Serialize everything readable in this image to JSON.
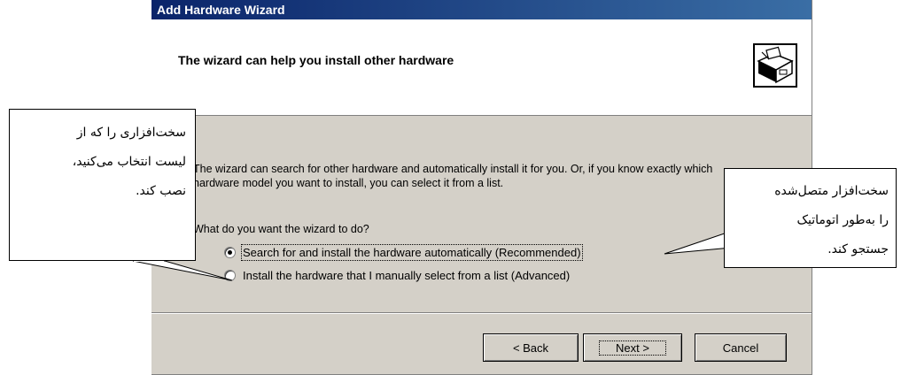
{
  "window": {
    "title": "Add Hardware Wizard"
  },
  "header": {
    "title": "The wizard can help you install other hardware",
    "icon": "hardware-install-icon"
  },
  "content": {
    "description": "The wizard can search for other hardware and automatically install it for you. Or, if you know exactly which hardware model you want to install, you can select it from a list.",
    "question": "What do you want the wizard to do?",
    "options": [
      {
        "label": "Search for and install the hardware automatically (Recommended)",
        "selected": true
      },
      {
        "label": "Install the hardware that I manually select from a list (Advanced)",
        "selected": false
      }
    ]
  },
  "buttons": {
    "back": "< Back",
    "next": "Next >",
    "cancel": "Cancel"
  },
  "callouts": {
    "left": {
      "lines": [
        "سخت‌افزاری را که از",
        "لیست انتخاب می‌کنید،",
        "نصب کند."
      ]
    },
    "right": {
      "lines": [
        "سخت‌افزار متصل‌شده",
        "را به‌طور اتوماتیک",
        "جستجو کند."
      ]
    }
  }
}
